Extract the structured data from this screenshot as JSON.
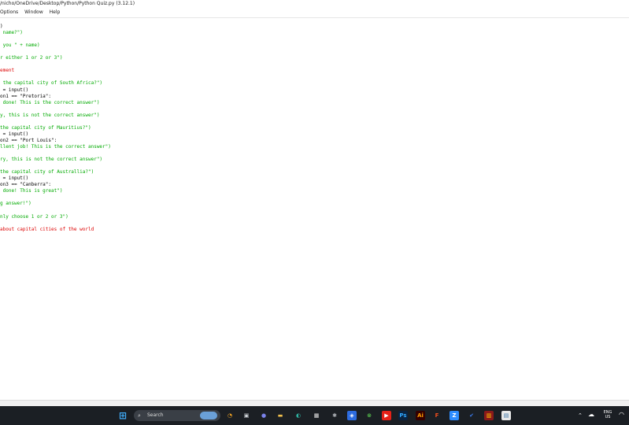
{
  "window": {
    "title": "/nicho/OneDrive/Desktop/Python/Python Quiz.py (3.12.1)"
  },
  "menu": {
    "items": [
      "Options",
      "Window",
      "Help"
    ]
  },
  "editor": {
    "lines": [
      {
        "text": ")",
        "cls": "plain"
      },
      {
        "text": " name?\")",
        "cls": "str"
      },
      {
        "text": "",
        "cls": "plain"
      },
      {
        "text": " you \" + name)",
        "cls": "str"
      },
      {
        "text": "",
        "cls": "plain"
      },
      {
        "text": "r either 1 or 2 or 3\")",
        "cls": "str"
      },
      {
        "text": "",
        "cls": "plain"
      },
      {
        "text": "ement",
        "cls": "cmt"
      },
      {
        "text": "",
        "cls": "plain"
      },
      {
        "text": " the capital city of South Africa?\")",
        "cls": "str"
      },
      {
        "text": " = input()",
        "cls": "plain"
      },
      {
        "text": "on1 == \"Pretoria\":",
        "cls": "plain"
      },
      {
        "text": " done! This is the correct answer\")",
        "cls": "str"
      },
      {
        "text": "",
        "cls": "plain"
      },
      {
        "text": "y, this is not the correct answer\")",
        "cls": "str"
      },
      {
        "text": "",
        "cls": "plain"
      },
      {
        "text": "the capital city of Mauritius?\")",
        "cls": "str"
      },
      {
        "text": " = input()",
        "cls": "plain"
      },
      {
        "text": "on2 == \"Port Louis\":",
        "cls": "plain"
      },
      {
        "text": "llent job! This is the correct answer\")",
        "cls": "str"
      },
      {
        "text": "",
        "cls": "plain"
      },
      {
        "text": "ry, this is not the correct answer\")",
        "cls": "str"
      },
      {
        "text": "",
        "cls": "plain"
      },
      {
        "text": "the capital city of Australlia?\")",
        "cls": "str"
      },
      {
        "text": " = input()",
        "cls": "plain"
      },
      {
        "text": "on3 == \"Canberra\":",
        "cls": "plain"
      },
      {
        "text": " done! This is great\")",
        "cls": "str"
      },
      {
        "text": "",
        "cls": "plain"
      },
      {
        "text": "g answer!\")",
        "cls": "str"
      },
      {
        "text": "",
        "cls": "plain"
      },
      {
        "text": "nly choose 1 or 2 or 3\")",
        "cls": "str"
      },
      {
        "text": "",
        "cls": "plain"
      },
      {
        "text": "about capital cities of the world",
        "cls": "cmt"
      }
    ]
  },
  "taskbar": {
    "search_label": "Search",
    "lang_top": "ENG",
    "lang_bottom": "US",
    "icons": [
      {
        "name": "start-icon",
        "glyph": "⊞",
        "bg": "#1b1f24",
        "fg": "#3fa9f5"
      },
      {
        "name": "widgets-icon",
        "glyph": "◔",
        "bg": "#1b1f24",
        "fg": "#f5a623"
      },
      {
        "name": "task-view-icon",
        "glyph": "▣",
        "bg": "#1b1f24",
        "fg": "#cfd3d8"
      },
      {
        "name": "teams-icon",
        "glyph": "●",
        "bg": "#1b1f24",
        "fg": "#7b83eb"
      },
      {
        "name": "file-explorer-icon",
        "glyph": "▬",
        "bg": "#1b1f24",
        "fg": "#f2c14e"
      },
      {
        "name": "edge-icon",
        "glyph": "◐",
        "bg": "#1b1f24",
        "fg": "#2fb5a3"
      },
      {
        "name": "store-icon",
        "glyph": "▦",
        "bg": "#1b1f24",
        "fg": "#e3e3e3"
      },
      {
        "name": "settings-icon",
        "glyph": "✱",
        "bg": "#1b1f24",
        "fg": "#b0b4b9"
      },
      {
        "name": "photos-icon",
        "glyph": "◈",
        "bg": "#2d6cdf",
        "fg": "#ffffff"
      },
      {
        "name": "xbox-icon",
        "glyph": "⊗",
        "bg": "#1b1f24",
        "fg": "#57c24e"
      },
      {
        "name": "youtube-icon",
        "glyph": "▶",
        "bg": "#e62117",
        "fg": "#ffffff"
      },
      {
        "name": "photoshop-icon",
        "glyph": "Ps",
        "bg": "#0a2341",
        "fg": "#31a8ff"
      },
      {
        "name": "illustrator-icon",
        "glyph": "Ai",
        "bg": "#330000",
        "fg": "#ff9a00"
      },
      {
        "name": "figma-icon",
        "glyph": "F",
        "bg": "#1b1f24",
        "fg": "#f24e1e"
      },
      {
        "name": "zoom-icon",
        "glyph": "Z",
        "bg": "#2d8cff",
        "fg": "#ffffff"
      },
      {
        "name": "todo-icon",
        "glyph": "✔",
        "bg": "#1b1f24",
        "fg": "#3b7cf0"
      },
      {
        "name": "winrar-icon",
        "glyph": "▥",
        "bg": "#8b1a1a",
        "fg": "#ffcc00"
      },
      {
        "name": "python-idle-icon",
        "glyph": "▤",
        "bg": "#e8e8e8",
        "fg": "#3671a5"
      }
    ]
  }
}
